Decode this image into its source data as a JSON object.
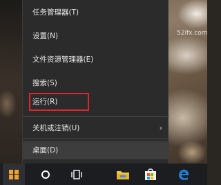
{
  "watermark": "52ifx.com",
  "menu": {
    "items": [
      {
        "label": "任务管理器(T)"
      },
      {
        "label": "设置(N)"
      },
      {
        "label": "文件资源管理器(E)"
      },
      {
        "label": "搜索(S)"
      },
      {
        "label": "运行(R)"
      },
      {
        "label": "关机或注销(U)",
        "submenu_arrow": "›"
      },
      {
        "label": "桌面(D)"
      }
    ]
  },
  "taskbar": {
    "icons": [
      "windows-start-icon",
      "cortana-icon",
      "task-view-icon",
      "file-explorer-icon",
      "store-icon",
      "edge-icon"
    ]
  },
  "colors": {
    "highlight_border": "#e0252c",
    "menu_bg": "#2b2b2b",
    "taskbar_bg": "#1b1d20",
    "start_logo": "#f0a030",
    "edge_blue": "#1e7fd8"
  }
}
